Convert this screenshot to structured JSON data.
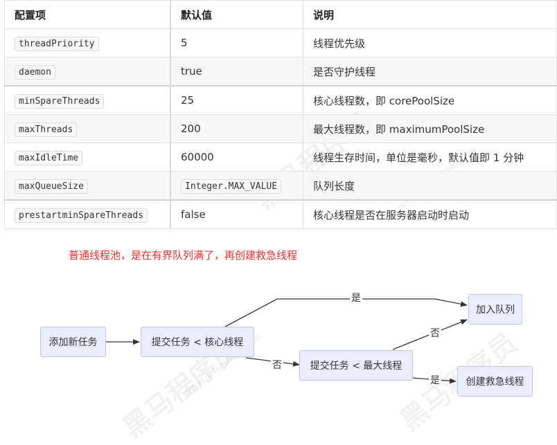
{
  "table": {
    "headers": [
      "配置项",
      "默认值",
      "说明"
    ],
    "rows": [
      {
        "key": "threadPriority",
        "default": "5",
        "desc": "线程优先级"
      },
      {
        "key": "daemon",
        "default": "true",
        "desc": "是否守护线程"
      },
      {
        "key": "minSpareThreads",
        "default": "25",
        "desc": "核心线程数，即 corePoolSize"
      },
      {
        "key": "maxThreads",
        "default": "200",
        "desc": "最大线程数，即 maximumPoolSize"
      },
      {
        "key": "maxIdleTime",
        "default": "60000",
        "desc": "线程生存时间，单位是毫秒，默认值即 1 分钟"
      },
      {
        "key": "maxQueueSize",
        "default": "Integer.MAX_VALUE",
        "desc": "队列长度"
      },
      {
        "key": "prestartminSpareThreads",
        "default": "false",
        "desc": "核心线程是否在服务器启动时启动"
      }
    ]
  },
  "note": "普通线程池，是在有界队列满了，再创建救急线程",
  "flow": {
    "nodes": {
      "add_task": "添加新任务",
      "submit_core": "提交任务 < 核心线程",
      "submit_max": "提交任务 < 最大线程",
      "join_queue": "加入队列",
      "create_emergency": "创建救急线程"
    },
    "edges": {
      "yes_top": "是",
      "no_core": "否",
      "no_max": "否",
      "yes_max": "是"
    }
  },
  "watermark": {
    "brand": "黑马程序员",
    "url": "www.itheima.com"
  }
}
